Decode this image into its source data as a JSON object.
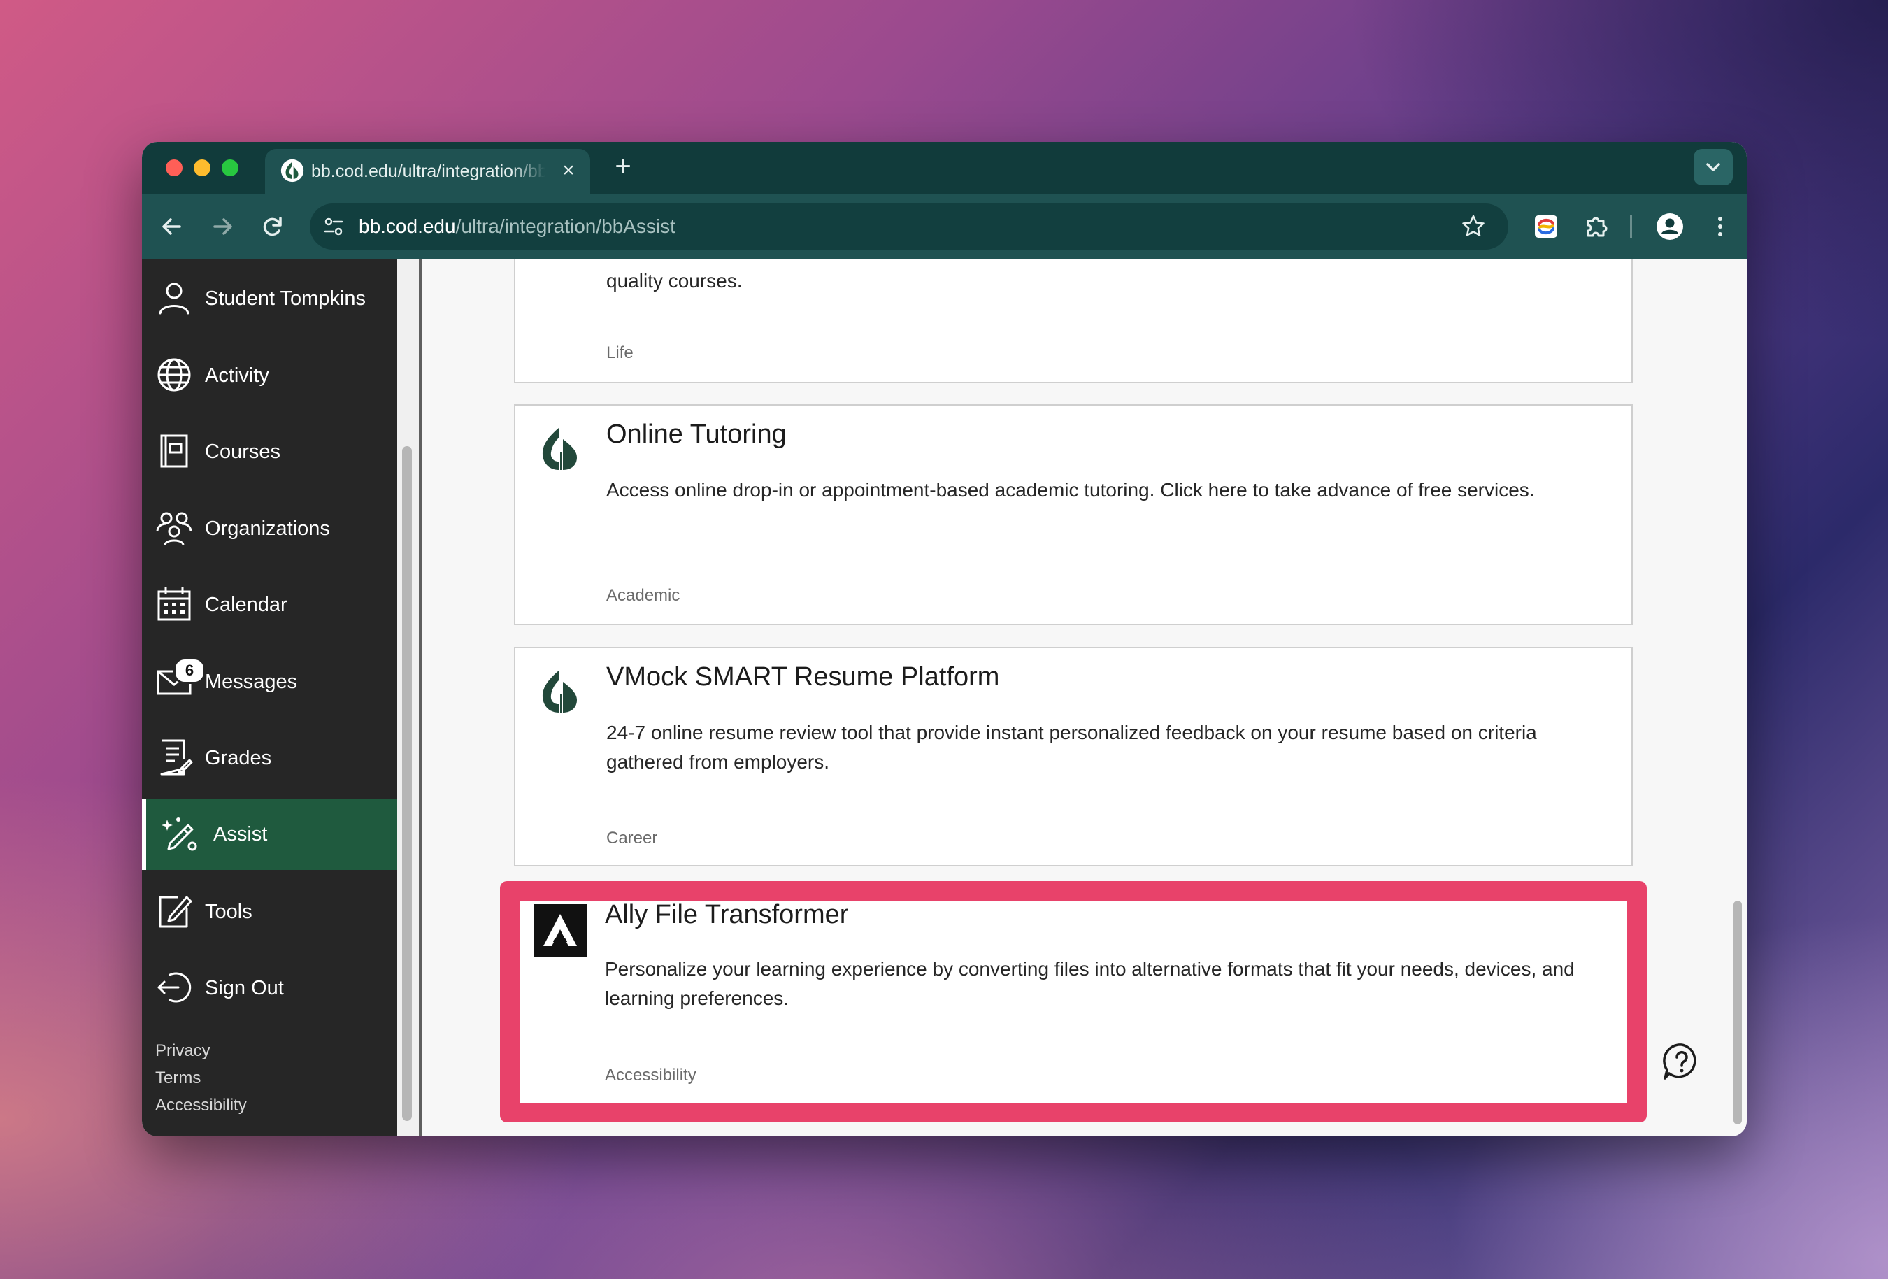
{
  "browser": {
    "tab_title": "bb.cod.edu/ultra/integration/bbAssist",
    "url_host": "bb.cod.edu",
    "url_path": "/ultra/integration/bbAssist",
    "new_tab_symbol": "+",
    "close_symbol": "×"
  },
  "sidebar": {
    "items": [
      {
        "label": "Student Tompkins",
        "icon": "user-icon"
      },
      {
        "label": "Activity",
        "icon": "globe-icon"
      },
      {
        "label": "Courses",
        "icon": "book-icon"
      },
      {
        "label": "Organizations",
        "icon": "group-icon"
      },
      {
        "label": "Calendar",
        "icon": "calendar-icon"
      },
      {
        "label": "Messages",
        "icon": "envelope-icon",
        "badge": "6"
      },
      {
        "label": "Grades",
        "icon": "grades-icon"
      },
      {
        "label": "Assist",
        "icon": "assist-icon",
        "active": true
      },
      {
        "label": "Tools",
        "icon": "tools-icon"
      },
      {
        "label": "Sign Out",
        "icon": "sign-out-icon"
      }
    ],
    "footer": [
      "Privacy",
      "Terms",
      "Accessibility"
    ]
  },
  "cards": [
    {
      "title": "",
      "description": "quality courses.",
      "category": "Life"
    },
    {
      "title": "Online Tutoring",
      "description": "Access online drop-in or appointment-based academic tutoring. Click here to take advance of free services.",
      "category": "Academic",
      "logo": "cod-logo-icon"
    },
    {
      "title": "VMock SMART Resume Platform",
      "description": "24-7 online resume review tool that provide instant personalized feedback on your resume based on criteria gathered from employers.",
      "category": "Career",
      "logo": "cod-logo-icon"
    },
    {
      "title": "Ally File Transformer",
      "description": "Personalize your learning experience by converting files into alternative formats that fit your needs, devices, and learning preferences.",
      "category": "Accessibility",
      "logo": "ally-logo-icon"
    }
  ],
  "colors": {
    "browser_frame": "#113b3b",
    "toolbar": "#1f5252",
    "sidebar": "#262626",
    "active_nav": "#1f5a3e",
    "highlight": "#e8426a"
  }
}
